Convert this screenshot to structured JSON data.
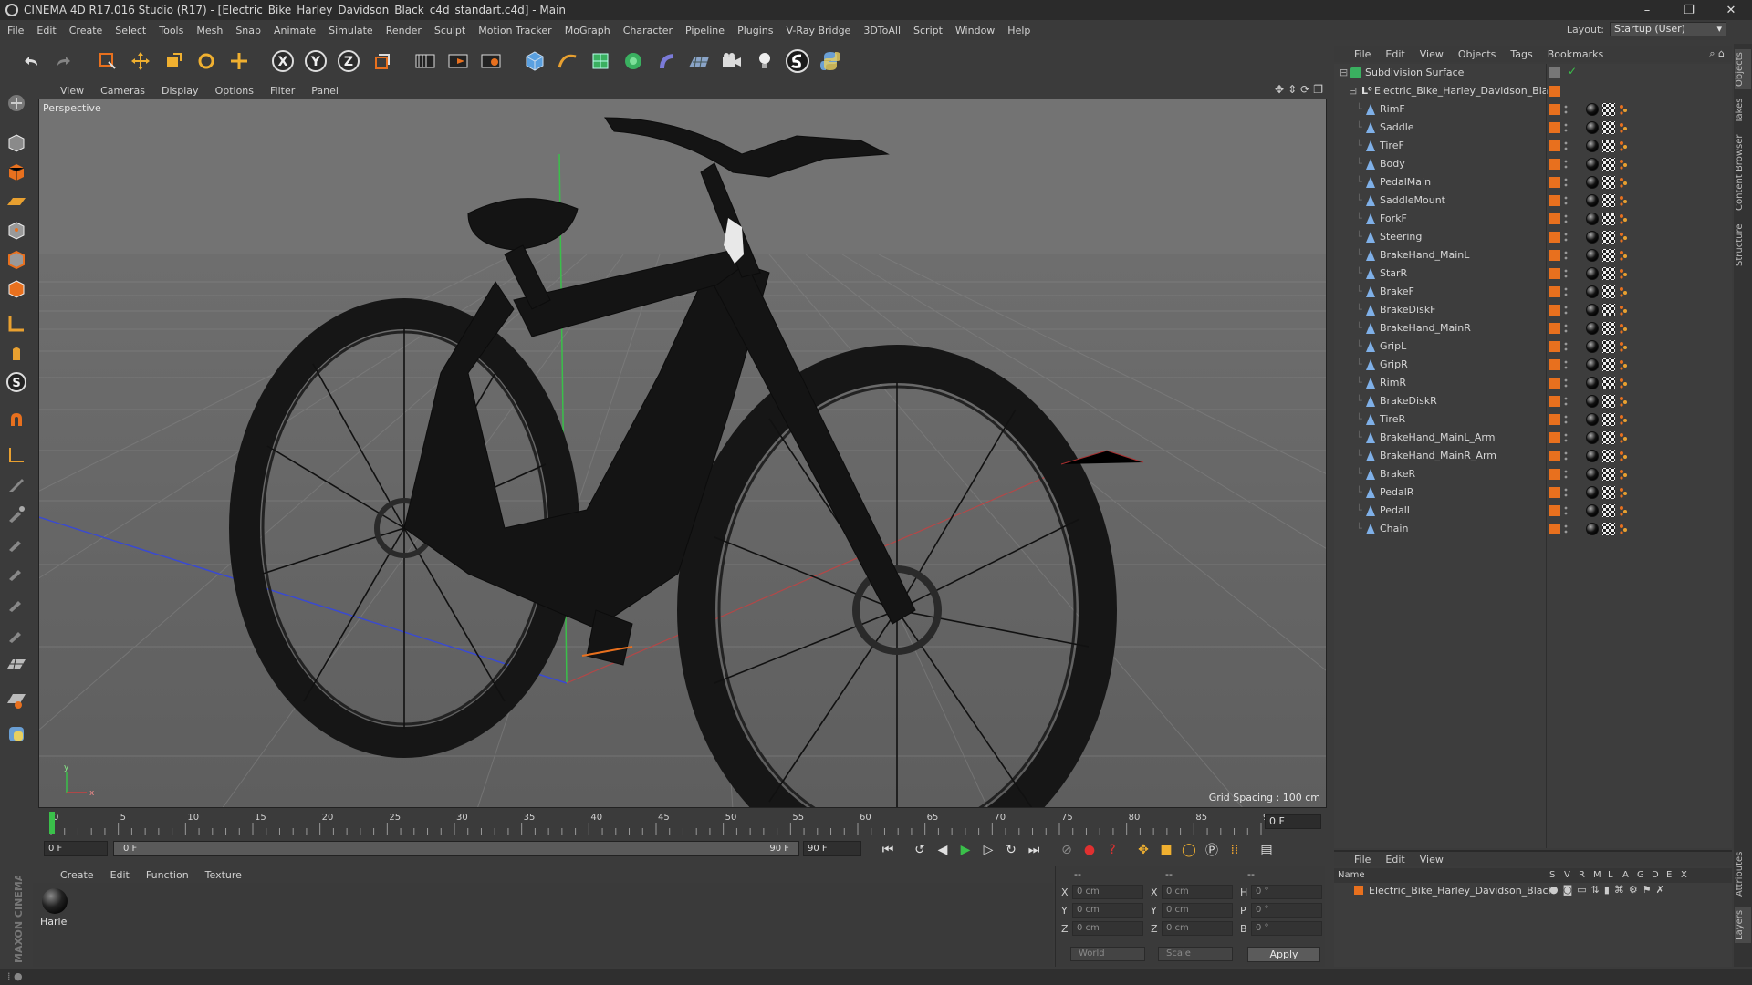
{
  "window": {
    "title": "CINEMA 4D R17.016 Studio (R17) - [Electric_Bike_Harley_Davidson_Black_c4d_standart.c4d] - Main"
  },
  "menubar": [
    "File",
    "Edit",
    "Create",
    "Select",
    "Tools",
    "Mesh",
    "Snap",
    "Animate",
    "Simulate",
    "Render",
    "Sculpt",
    "Motion Tracker",
    "MoGraph",
    "Character",
    "Pipeline",
    "Plugins",
    "V-Ray Bridge",
    "3DToAll",
    "Script",
    "Window",
    "Help"
  ],
  "layout": {
    "label": "Layout:",
    "value": "Startup (User)"
  },
  "viewport": {
    "menu": [
      "View",
      "Cameras",
      "Display",
      "Options",
      "Filter",
      "Panel"
    ],
    "label": "Perspective",
    "grid_spacing": "Grid Spacing : 100 cm"
  },
  "timeline": {
    "ticks": [
      "0",
      "5",
      "10",
      "15",
      "20",
      "25",
      "30",
      "35",
      "40",
      "45",
      "50",
      "55",
      "60",
      "65",
      "70",
      "75",
      "80",
      "85",
      "90"
    ],
    "current_frame": "0 F"
  },
  "transport": {
    "start_field": "0 F",
    "range_start": "0 F",
    "range_end": "90 F",
    "end_field": "90 F"
  },
  "material_manager": {
    "menu": [
      "Create",
      "Edit",
      "Function",
      "Texture"
    ],
    "material_name": "Harle"
  },
  "coordinates": {
    "header_left": "--",
    "header_mid": "--",
    "header_right": "--",
    "rows": [
      {
        "axis": "X",
        "pos": "0 cm",
        "axis2": "X",
        "size": "0 cm",
        "rot_axis": "H",
        "rot": "0 °"
      },
      {
        "axis": "Y",
        "pos": "0 cm",
        "axis2": "Y",
        "size": "0 cm",
        "rot_axis": "P",
        "rot": "0 °"
      },
      {
        "axis": "Z",
        "pos": "0 cm",
        "axis2": "Z",
        "size": "0 cm",
        "rot_axis": "B",
        "rot": "0 °"
      }
    ],
    "mode1": "World",
    "mode2": "Scale",
    "apply": "Apply"
  },
  "object_manager": {
    "menu": [
      "File",
      "Edit",
      "View",
      "Objects",
      "Tags",
      "Bookmarks"
    ],
    "root": "Subdivision Surface",
    "group": "Electric_Bike_Harley_Davidson_Black",
    "objects": [
      "RimF",
      "Saddle",
      "TireF",
      "Body",
      "PedalMain",
      "SaddleMount",
      "ForkF",
      "Steering",
      "BrakeHand_MainL",
      "StarR",
      "BrakeF",
      "BrakeDiskF",
      "BrakeHand_MainR",
      "GripL",
      "GripR",
      "RimR",
      "BrakeDiskR",
      "TireR",
      "BrakeHand_MainL_Arm",
      "BrakeHand_MainR_Arm",
      "BrakeR",
      "PedalR",
      "PedalL",
      "Chain"
    ]
  },
  "layer_manager": {
    "menu": [
      "File",
      "Edit",
      "View"
    ],
    "columns": [
      "Name",
      "S",
      "V",
      "R",
      "M",
      "L",
      "A",
      "G",
      "D",
      "E",
      "X"
    ],
    "layer": "Electric_Bike_Harley_Davidson_Black"
  },
  "right_tabs": [
    "Objects",
    "Takes",
    "Content Browser",
    "Structure",
    "Attributes",
    "Layers"
  ],
  "brand": "MAXON CINEMA 4D",
  "colors": {
    "accent_orange": "#e8701e",
    "bg": "#3b3b3b",
    "viewport": "#6c6c6c"
  }
}
